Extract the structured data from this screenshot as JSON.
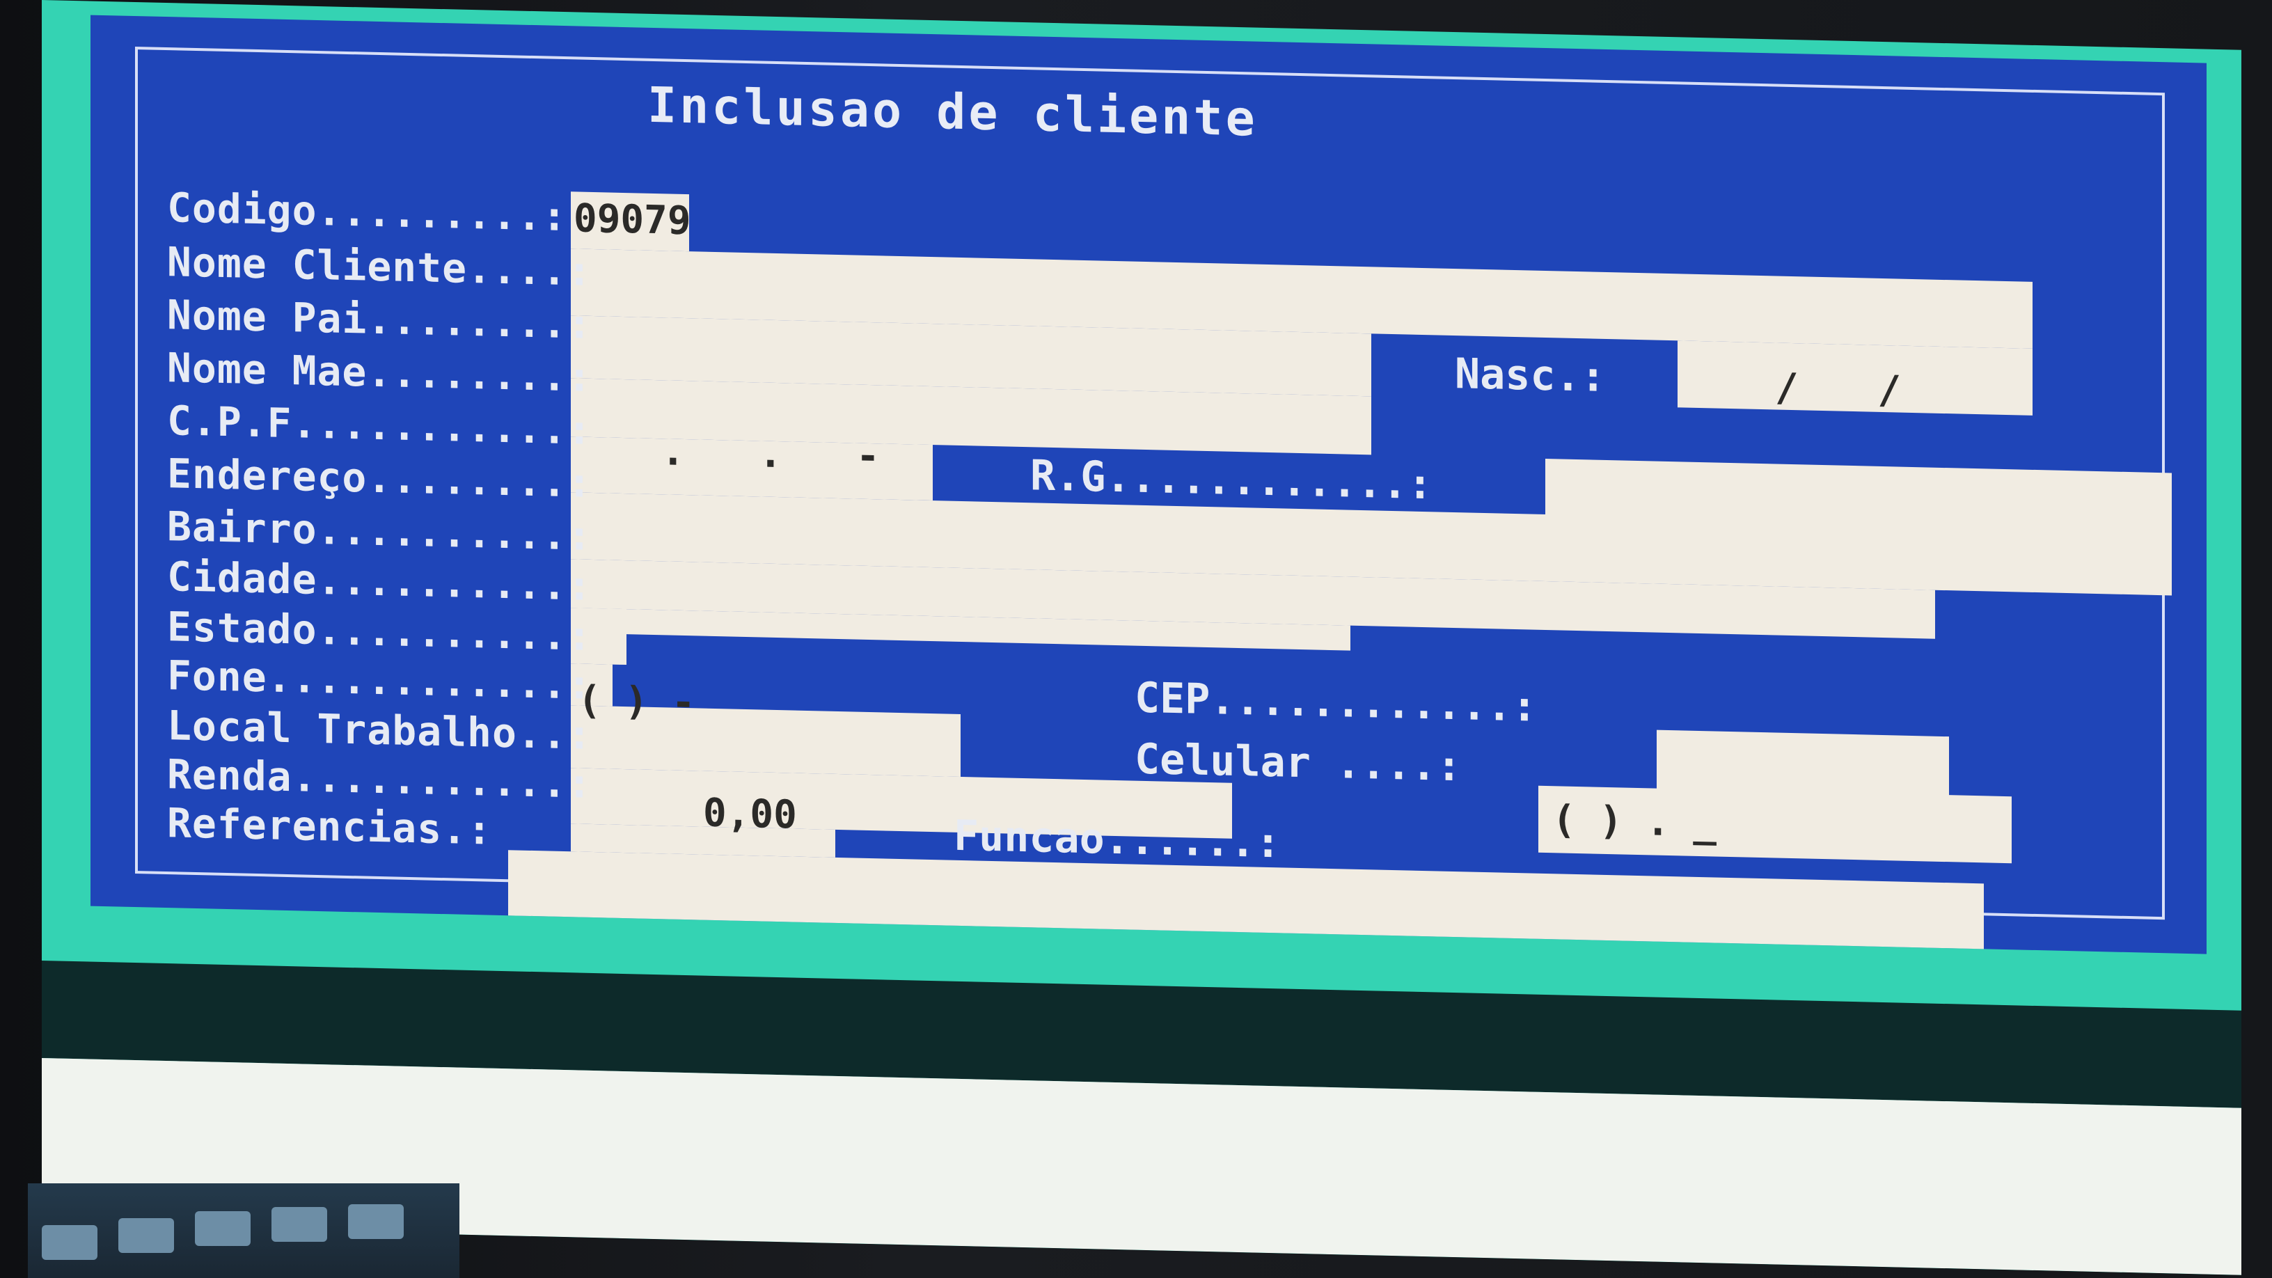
{
  "window": {
    "title": "Inclusao de cliente"
  },
  "labels": {
    "codigo": "Codigo.........:",
    "nome_cliente": "Nome Cliente....:",
    "nome_pai": "Nome Pai........:",
    "nome_mae": "Nome Mae........:",
    "cpf": "C.P.F...........:",
    "endereco": "Endereço........:",
    "bairro": "Bairro..........:",
    "cidade": "Cidade..........:",
    "estado": "Estado..........:",
    "fone": "Fone............:",
    "local_trabalho": "Local Trabalho..:",
    "renda": "Renda...........:",
    "referencias": "Referencias.:",
    "nasc": "Nasc.:",
    "rg": "R.G............:",
    "cep": "CEP............:",
    "celular": "Celular ....:",
    "funcao": "Funcao......:"
  },
  "values": {
    "codigo": "09079",
    "nasc_sep": "/ /",
    "cpf_sep1": ".",
    "cpf_sep2": ".",
    "cpf_sep3": "-",
    "fone_mask": "(      )      -",
    "celular_mask": "(      )      .    _",
    "renda": "0,00"
  },
  "colors": {
    "window_bg": "#1f45b8",
    "field_bg": "#f1ece2",
    "desktop": "#34d3b3",
    "text_light": "#e7ebf4"
  }
}
